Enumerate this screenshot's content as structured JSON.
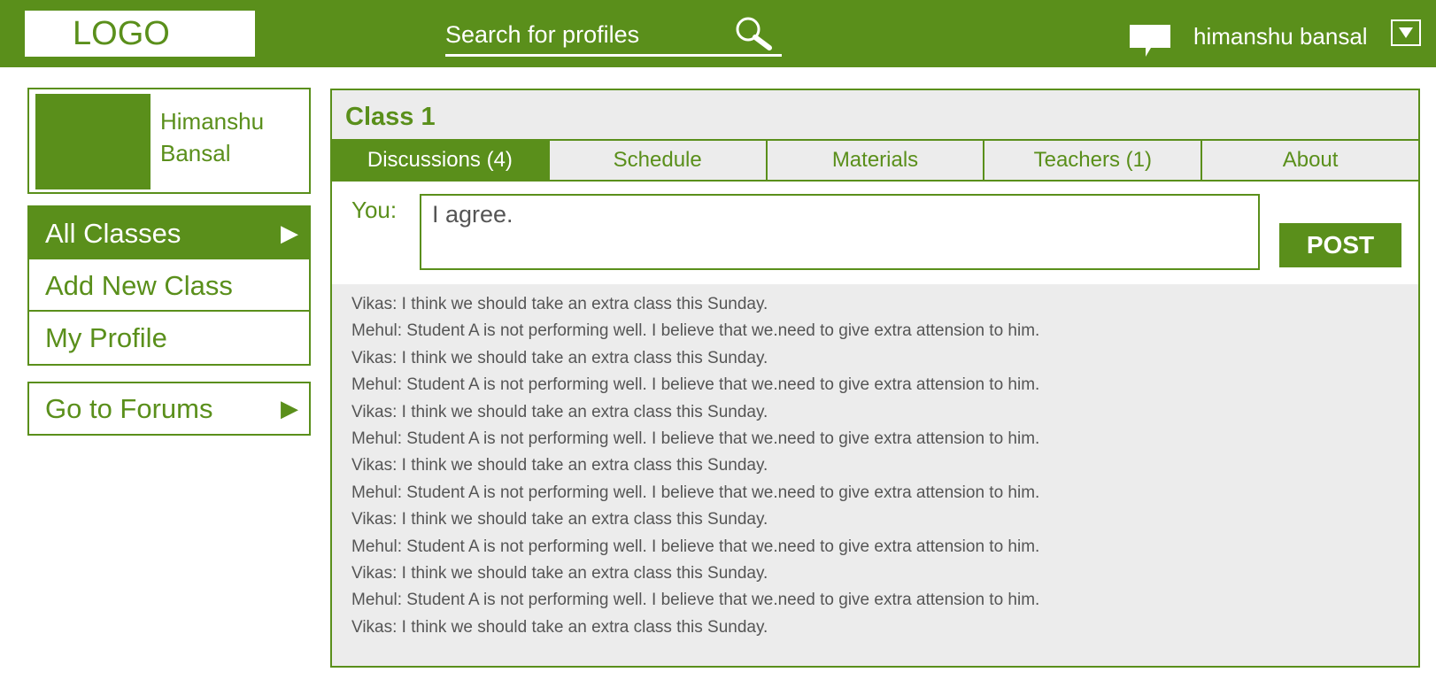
{
  "header": {
    "logo": "LOGO",
    "search_placeholder": "Search for profiles",
    "user_name": "himanshu bansal",
    "icons": {
      "search": "search-icon",
      "chat": "chat-icon",
      "menu": "dropdown-arrow-icon"
    }
  },
  "profile": {
    "first_name": "Himanshu",
    "last_name": "Bansal"
  },
  "nav": {
    "items": [
      {
        "label": "All Classes",
        "arrow": "▶",
        "active": true
      },
      {
        "label": "Add New Class"
      },
      {
        "label": "My Profile"
      }
    ]
  },
  "forums": {
    "label": "Go to Forums",
    "arrow": "▶"
  },
  "main": {
    "title": "Class 1",
    "tabs": [
      {
        "label": "Discussions (4)",
        "active": true
      },
      {
        "label": "Schedule"
      },
      {
        "label": "Materials"
      },
      {
        "label": "Teachers (1)"
      },
      {
        "label": "About"
      }
    ],
    "compose": {
      "you_label": "You:",
      "value": "I agree.",
      "post_label": "POST"
    },
    "messages": [
      "Vikas: I think we should take an extra class this Sunday.",
      "Mehul: Student A is not performing well. I believe that we.need to give extra attension to him.",
      "Vikas: I think we should take an extra class this Sunday.",
      "Mehul: Student A is not performing well. I believe that we.need to give extra attension to him.",
      "Vikas: I think we should take an extra class this Sunday.",
      "Mehul: Student A is not performing well. I believe that we.need to give extra attension to him.",
      "Vikas: I think we should take an extra class this Sunday.",
      "Mehul: Student A is not performing well. I believe that we.need to give extra attension to him.",
      "Vikas: I think we should take an extra class this Sunday.",
      "Mehul: Student A is not performing well. I believe that we.need to give extra attension to him.",
      "Vikas: I think we should take an extra class this Sunday.",
      "Mehul: Student A is not performing well. I believe that we.need to give extra attension to him.",
      "Vikas: I think we should take an extra class this Sunday."
    ]
  },
  "colors": {
    "brand": "#5a8f1b",
    "panel_bg": "#ececec",
    "message_text": "#555555"
  }
}
